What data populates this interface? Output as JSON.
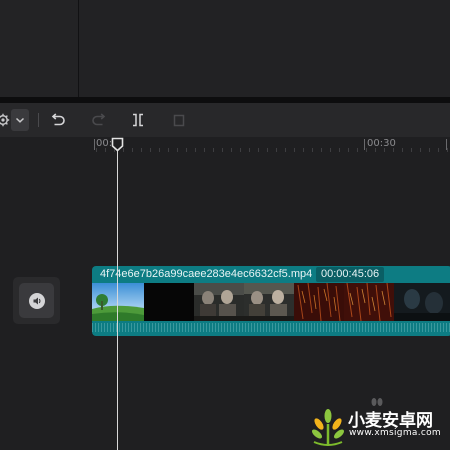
{
  "toolbar": {
    "tools": [
      {
        "name": "settings",
        "icon": "gear-icon"
      },
      {
        "name": "dropdown",
        "icon": "chevron-down-icon"
      },
      {
        "name": "undo",
        "icon": "undo-icon"
      },
      {
        "name": "redo",
        "icon": "redo-icon"
      },
      {
        "name": "split",
        "icon": "split-icon"
      },
      {
        "name": "delete",
        "icon": "trash-icon"
      }
    ]
  },
  "ruler": {
    "labels": [
      "00:0",
      "00:30"
    ]
  },
  "audio": {
    "icon": "speaker-icon"
  },
  "clip": {
    "file_name": "4f74e6e7b26a99caee283e4ec6632cf5.mp4",
    "duration": "00:00:45:06",
    "color": "#0d7c83"
  },
  "watermark": {
    "title": "小麦安卓网",
    "url": "www.xmsigma.com"
  }
}
